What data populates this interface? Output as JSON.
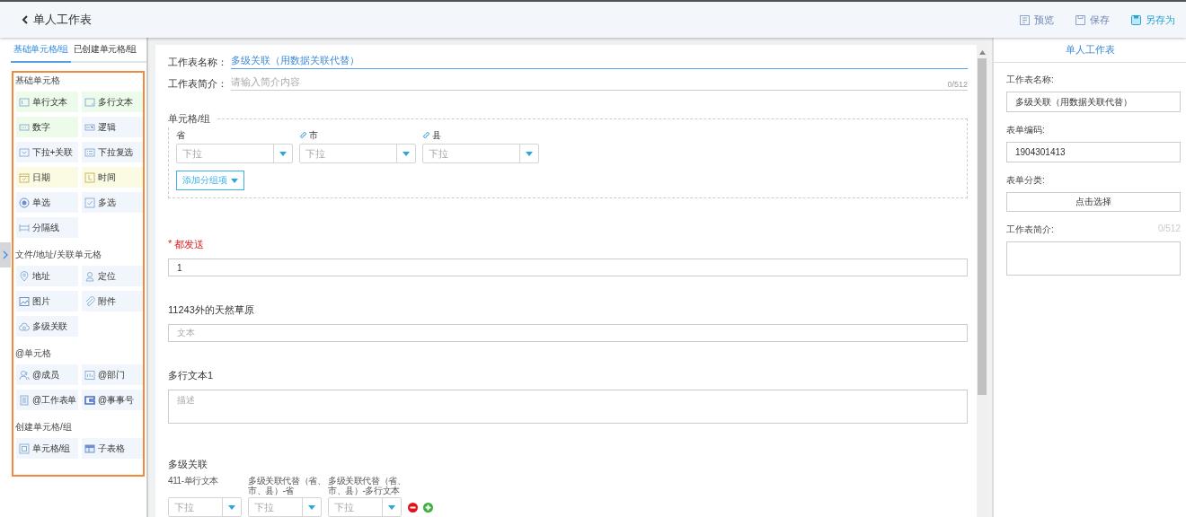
{
  "header": {
    "title": "单人工作表",
    "actions": [
      {
        "label": "预览"
      },
      {
        "label": "保存"
      },
      {
        "label": "另存为"
      }
    ]
  },
  "palette": {
    "tabs": [
      {
        "label": "基础单元格/组",
        "selected": true
      },
      {
        "label": "已创建单元格/组",
        "selected": false
      }
    ],
    "groups": [
      {
        "title": "基础单元格",
        "items": [
          {
            "label": "单行文本",
            "color": "#ecfbea"
          },
          {
            "label": "多行文本",
            "color": "#ecfbea"
          },
          {
            "label": "数字",
            "color": "#ecfbea"
          },
          {
            "label": "逻辑",
            "color": "#f1f6fc"
          },
          {
            "label": "下拉+关联",
            "color": "#f1f6fc"
          },
          {
            "label": "下拉复选",
            "color": "#f1f6fc"
          },
          {
            "label": "日期",
            "color": "#fafbe2"
          },
          {
            "label": "时间",
            "color": "#fafbe2"
          },
          {
            "label": "单选",
            "color": "#f1f6fc"
          },
          {
            "label": "多选",
            "color": "#f1f6fc"
          },
          {
            "label": "分隔线",
            "color": "#f1f6fc"
          }
        ]
      },
      {
        "title": "文件/地址/关联单元格",
        "items": [
          {
            "label": "地址",
            "color": "#f1f6fc"
          },
          {
            "label": "定位",
            "color": "#f1f6fc"
          },
          {
            "label": "图片",
            "color": "#f1f6fc"
          },
          {
            "label": "附件",
            "color": "#f1f6fc"
          },
          {
            "label": "多级关联",
            "color": "#f1f6fc"
          }
        ]
      },
      {
        "title": "@单元格",
        "items": [
          {
            "label": "@成员",
            "color": "#f1f6fc"
          },
          {
            "label": "@部门",
            "color": "#f1f6fc"
          },
          {
            "label": "@工作表单",
            "color": "#f1f6fc"
          },
          {
            "label": "@事事号",
            "color": "#f1f6fc"
          }
        ]
      },
      {
        "title": "创建单元格/组",
        "items": [
          {
            "label": "单元格/组",
            "color": "#f1f6fc"
          },
          {
            "label": "子表格",
            "color": "#f1f6fc"
          }
        ]
      }
    ]
  },
  "form": {
    "name_label": "工作表名称：",
    "name_value": "多级关联（用数据关联代替）",
    "intro_label": "工作表简介：",
    "intro_placeholder": "请输入简介内容",
    "intro_counter": "0/512",
    "group": {
      "title": "单元格/组",
      "columns": [
        {
          "label": "省",
          "linked": false,
          "placeholder": "下拉"
        },
        {
          "label": "市",
          "linked": true,
          "placeholder": "下拉"
        },
        {
          "label": "县",
          "linked": true,
          "placeholder": "下拉"
        }
      ],
      "add_button": "添加分组项"
    },
    "fields": [
      {
        "kind": "text",
        "label": "都发送",
        "required": true,
        "required_mark": "*",
        "value": "1"
      },
      {
        "kind": "text",
        "label": "11243外的天然草原",
        "required": false,
        "placeholder": "文本"
      },
      {
        "kind": "textarea",
        "label": "多行文本1",
        "required": false,
        "placeholder": "描述"
      },
      {
        "kind": "cascade",
        "label": "多级关联",
        "required": false,
        "columns": [
          {
            "label": "411-单行文本",
            "placeholder": "下拉"
          },
          {
            "label": "多级关联代替（省、市、县）-省",
            "placeholder": "下拉"
          },
          {
            "label": "多级关联代替（省、市、县）-多行文本",
            "placeholder": "下拉"
          }
        ]
      }
    ]
  },
  "properties": {
    "title": "单人工作表",
    "fields": [
      {
        "kind": "input",
        "label": "工作表名称:",
        "value": "多级关联（用数据关联代替）"
      },
      {
        "kind": "input",
        "label": "表单编码:",
        "value": "1904301413"
      },
      {
        "kind": "button",
        "label": "表单分类:",
        "button": "点击选择"
      },
      {
        "kind": "textarea",
        "label": "工作表简介:",
        "counter": "0/512"
      }
    ]
  }
}
